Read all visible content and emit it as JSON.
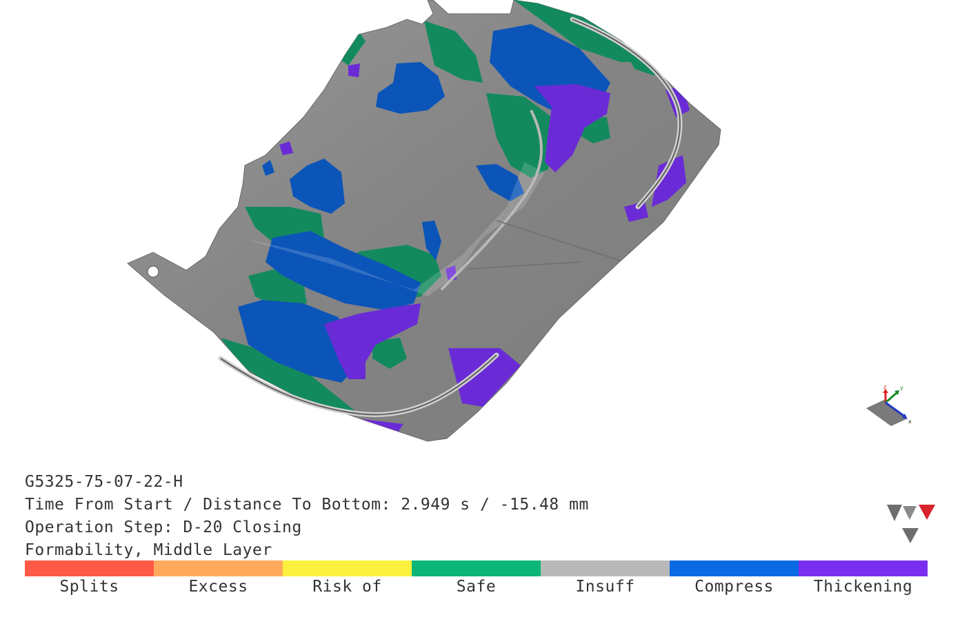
{
  "info": {
    "part_id": "G5325-75-07-22-H",
    "time_distance": "Time From Start / Distance To Bottom: 2.949 s / -15.48 mm",
    "operation_step": "Operation Step: D-20 Closing",
    "result_type": "Formability, Middle Layer"
  },
  "legend": [
    {
      "label": "Splits",
      "color": "#ff5a46"
    },
    {
      "label": "Excess",
      "color": "#ffa95c"
    },
    {
      "label": "Risk of",
      "color": "#fbf03c"
    },
    {
      "label": "Safe",
      "color": "#0cb679"
    },
    {
      "label": "Insuff",
      "color": "#b9b9b9"
    },
    {
      "label": "Compress",
      "color": "#0a6ae4"
    },
    {
      "label": "Thickening",
      "color": "#7a2ff0"
    }
  ],
  "triad": {
    "x_label": "x",
    "y_label": "y",
    "z_label": "z"
  },
  "colors": {
    "part_gray": "#8c8c8c",
    "safe": "#138a5e",
    "compress": "#0c55b8",
    "thickening": "#6a2bd6"
  }
}
